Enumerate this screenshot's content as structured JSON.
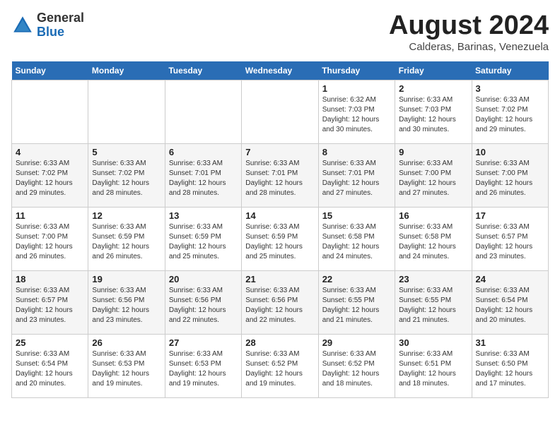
{
  "logo": {
    "general": "General",
    "blue": "Blue"
  },
  "header": {
    "month": "August 2024",
    "location": "Calderas, Barinas, Venezuela"
  },
  "weekdays": [
    "Sunday",
    "Monday",
    "Tuesday",
    "Wednesday",
    "Thursday",
    "Friday",
    "Saturday"
  ],
  "weeks": [
    [
      {
        "day": "",
        "info": ""
      },
      {
        "day": "",
        "info": ""
      },
      {
        "day": "",
        "info": ""
      },
      {
        "day": "",
        "info": ""
      },
      {
        "day": "1",
        "sunrise": "6:32 AM",
        "sunset": "7:03 PM",
        "daylight": "12 hours and 30 minutes."
      },
      {
        "day": "2",
        "sunrise": "6:33 AM",
        "sunset": "7:03 PM",
        "daylight": "12 hours and 30 minutes."
      },
      {
        "day": "3",
        "sunrise": "6:33 AM",
        "sunset": "7:02 PM",
        "daylight": "12 hours and 29 minutes."
      }
    ],
    [
      {
        "day": "4",
        "sunrise": "6:33 AM",
        "sunset": "7:02 PM",
        "daylight": "12 hours and 29 minutes."
      },
      {
        "day": "5",
        "sunrise": "6:33 AM",
        "sunset": "7:02 PM",
        "daylight": "12 hours and 28 minutes."
      },
      {
        "day": "6",
        "sunrise": "6:33 AM",
        "sunset": "7:01 PM",
        "daylight": "12 hours and 28 minutes."
      },
      {
        "day": "7",
        "sunrise": "6:33 AM",
        "sunset": "7:01 PM",
        "daylight": "12 hours and 28 minutes."
      },
      {
        "day": "8",
        "sunrise": "6:33 AM",
        "sunset": "7:01 PM",
        "daylight": "12 hours and 27 minutes."
      },
      {
        "day": "9",
        "sunrise": "6:33 AM",
        "sunset": "7:00 PM",
        "daylight": "12 hours and 27 minutes."
      },
      {
        "day": "10",
        "sunrise": "6:33 AM",
        "sunset": "7:00 PM",
        "daylight": "12 hours and 26 minutes."
      }
    ],
    [
      {
        "day": "11",
        "sunrise": "6:33 AM",
        "sunset": "7:00 PM",
        "daylight": "12 hours and 26 minutes."
      },
      {
        "day": "12",
        "sunrise": "6:33 AM",
        "sunset": "6:59 PM",
        "daylight": "12 hours and 26 minutes."
      },
      {
        "day": "13",
        "sunrise": "6:33 AM",
        "sunset": "6:59 PM",
        "daylight": "12 hours and 25 minutes."
      },
      {
        "day": "14",
        "sunrise": "6:33 AM",
        "sunset": "6:59 PM",
        "daylight": "12 hours and 25 minutes."
      },
      {
        "day": "15",
        "sunrise": "6:33 AM",
        "sunset": "6:58 PM",
        "daylight": "12 hours and 24 minutes."
      },
      {
        "day": "16",
        "sunrise": "6:33 AM",
        "sunset": "6:58 PM",
        "daylight": "12 hours and 24 minutes."
      },
      {
        "day": "17",
        "sunrise": "6:33 AM",
        "sunset": "6:57 PM",
        "daylight": "12 hours and 23 minutes."
      }
    ],
    [
      {
        "day": "18",
        "sunrise": "6:33 AM",
        "sunset": "6:57 PM",
        "daylight": "12 hours and 23 minutes."
      },
      {
        "day": "19",
        "sunrise": "6:33 AM",
        "sunset": "6:56 PM",
        "daylight": "12 hours and 23 minutes."
      },
      {
        "day": "20",
        "sunrise": "6:33 AM",
        "sunset": "6:56 PM",
        "daylight": "12 hours and 22 minutes."
      },
      {
        "day": "21",
        "sunrise": "6:33 AM",
        "sunset": "6:56 PM",
        "daylight": "12 hours and 22 minutes."
      },
      {
        "day": "22",
        "sunrise": "6:33 AM",
        "sunset": "6:55 PM",
        "daylight": "12 hours and 21 minutes."
      },
      {
        "day": "23",
        "sunrise": "6:33 AM",
        "sunset": "6:55 PM",
        "daylight": "12 hours and 21 minutes."
      },
      {
        "day": "24",
        "sunrise": "6:33 AM",
        "sunset": "6:54 PM",
        "daylight": "12 hours and 20 minutes."
      }
    ],
    [
      {
        "day": "25",
        "sunrise": "6:33 AM",
        "sunset": "6:54 PM",
        "daylight": "12 hours and 20 minutes."
      },
      {
        "day": "26",
        "sunrise": "6:33 AM",
        "sunset": "6:53 PM",
        "daylight": "12 hours and 19 minutes."
      },
      {
        "day": "27",
        "sunrise": "6:33 AM",
        "sunset": "6:53 PM",
        "daylight": "12 hours and 19 minutes."
      },
      {
        "day": "28",
        "sunrise": "6:33 AM",
        "sunset": "6:52 PM",
        "daylight": "12 hours and 19 minutes."
      },
      {
        "day": "29",
        "sunrise": "6:33 AM",
        "sunset": "6:52 PM",
        "daylight": "12 hours and 18 minutes."
      },
      {
        "day": "30",
        "sunrise": "6:33 AM",
        "sunset": "6:51 PM",
        "daylight": "12 hours and 18 minutes."
      },
      {
        "day": "31",
        "sunrise": "6:33 AM",
        "sunset": "6:50 PM",
        "daylight": "12 hours and 17 minutes."
      }
    ]
  ]
}
